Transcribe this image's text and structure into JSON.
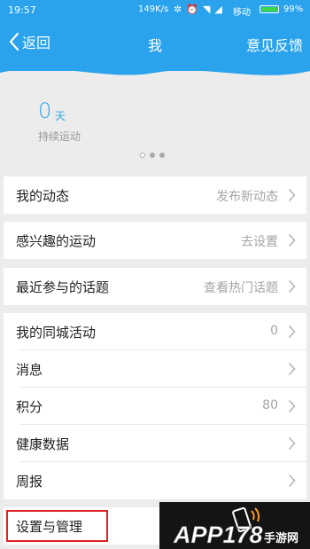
{
  "status_bar": {
    "time": "19:57",
    "network_speed": "149K/s",
    "carrier": "移动",
    "battery": "99%",
    "battery_level": 0.99
  },
  "header": {
    "back_label": "返回",
    "title": "我",
    "feedback_label": "意见反馈"
  },
  "stats": {
    "value": "0",
    "unit": "天",
    "label": "持续运动",
    "page_count": 3,
    "active_page": 1
  },
  "menu": {
    "my_activity": {
      "label": "我的动态",
      "value": "发布新动态"
    },
    "interests": {
      "label": "感兴趣的运动",
      "value": "去设置"
    },
    "topics": {
      "label": "最近参与的话题",
      "value": "查看热门话题"
    },
    "city_events": {
      "label": "我的同城活动",
      "value": "0"
    },
    "messages": {
      "label": "消息"
    },
    "points": {
      "label": "积分",
      "value": "80"
    },
    "health": {
      "label": "健康数据"
    },
    "weekly": {
      "label": "周报"
    },
    "settings": {
      "label": "设置与管理"
    }
  },
  "watermark": {
    "text": "APP178",
    "sub": "手游网"
  },
  "colors": {
    "header_blue": "#2aa3ec",
    "accent_blue": "#2ea8ea",
    "highlight_red": "#e02020",
    "background": "#ececec"
  },
  "icons": {
    "back": "chevron-left-icon",
    "row_arrow": "chevron-right-icon",
    "battery": "battery-icon"
  }
}
